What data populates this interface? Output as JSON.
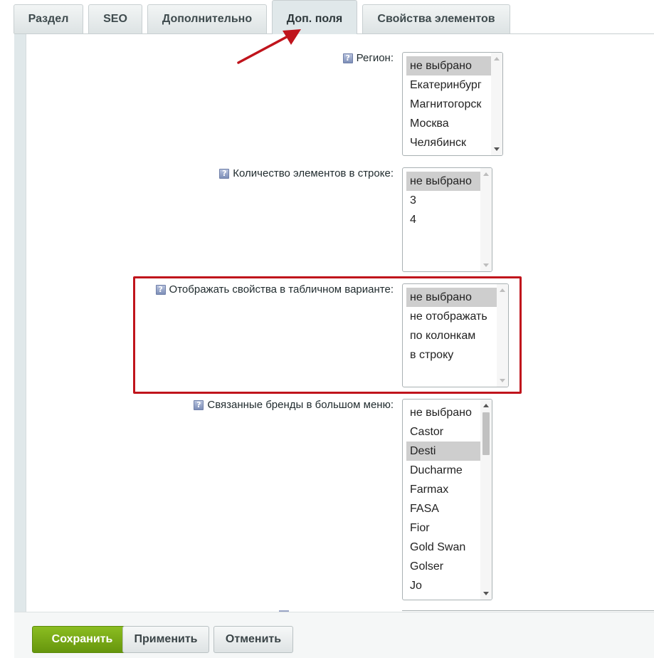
{
  "tabs": [
    {
      "label": "Раздел",
      "active": false
    },
    {
      "label": "SEO",
      "active": false
    },
    {
      "label": "Дополнительно",
      "active": false
    },
    {
      "label": "Доп. поля",
      "active": true
    },
    {
      "label": "Свойства элементов",
      "active": false
    }
  ],
  "help_glyph": "?",
  "fields": {
    "region": {
      "label": "Регион:",
      "options": [
        "не выбрано",
        "Екатеринбург",
        "Магнитогорск",
        "Москва",
        "Челябинск"
      ],
      "selected": "не выбрано"
    },
    "items_per_row": {
      "label": "Количество элементов в строке:",
      "options": [
        "не выбрано",
        "3",
        "4"
      ],
      "selected": "не выбрано"
    },
    "table_properties": {
      "label": "Отображать свойства в табличном варианте:",
      "options": [
        "не выбрано",
        "не отображать",
        "по колонкам",
        "в строку"
      ],
      "selected": "не выбрано"
    },
    "brands_menu": {
      "label": "Связанные бренды в большом меню:",
      "options": [
        "не выбрано",
        "Castor",
        "Desti",
        "Ducharme",
        "Farmax",
        "FASA",
        "Fior",
        "Gold Swan",
        "Golser",
        "Jo"
      ],
      "selected": "Desti"
    }
  },
  "buttons": {
    "save": "Сохранить",
    "apply": "Применить",
    "cancel": "Отменить"
  },
  "colors": {
    "annotation_red": "#c0141c",
    "save_green": "#7aab16"
  }
}
